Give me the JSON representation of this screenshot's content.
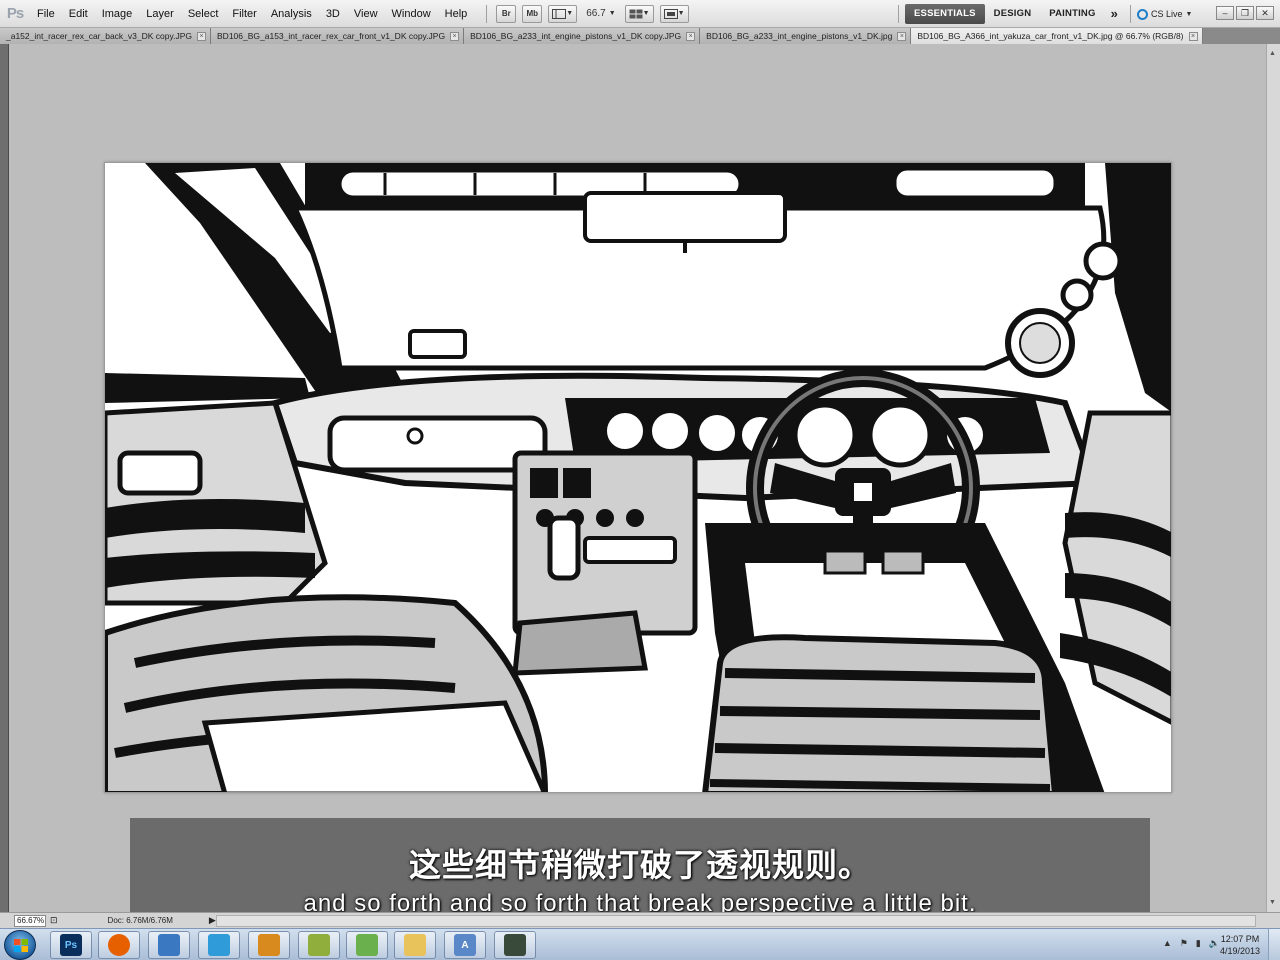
{
  "app": {
    "name": "Ps"
  },
  "menu": [
    "File",
    "Edit",
    "Image",
    "Layer",
    "Select",
    "Filter",
    "Analysis",
    "3D",
    "View",
    "Window",
    "Help"
  ],
  "toolbar": {
    "bridge_label": "Br",
    "minibridge_label": "Mb",
    "zoom_value": "66.7"
  },
  "workspaces": {
    "active": "ESSENTIALS",
    "items": [
      "ESSENTIALS",
      "DESIGN",
      "PAINTING"
    ],
    "more": "»",
    "cs_live": "CS Live"
  },
  "tabs": [
    {
      "label": "_a152_int_racer_rex_car_back_v3_DK copy.JPG",
      "active": false
    },
    {
      "label": "BD106_BG_a153_int_racer_rex_car_front_v1_DK copy.JPG",
      "active": false
    },
    {
      "label": "BD106_BG_a233_int_engine_pistons_v1_DK copy.JPG",
      "active": false
    },
    {
      "label": "BD106_BG_a233_int_engine_pistons_v1_DK.jpg",
      "active": false
    },
    {
      "label": "BD106_BG_A366_int_yakuza_car_front_v1_DK.jpg @ 66.7% (RGB/8)",
      "active": true
    }
  ],
  "subtitle": {
    "chinese": "这些细节稍微打破了透视规则。",
    "english": "and so forth and so forth that break perspective a little bit."
  },
  "status": {
    "zoom": "66.67%",
    "doc_info": "Doc: 6.76M/6.76M"
  },
  "taskbar": {
    "apps": [
      {
        "name": "photoshop",
        "label": "Ps",
        "color": "#0a2e5c",
        "text_color": "#6fc3ff"
      },
      {
        "name": "firefox",
        "label": "",
        "color": "#e66000"
      },
      {
        "name": "app-3",
        "label": "",
        "color": "#3b78c2"
      },
      {
        "name": "app-4",
        "label": "",
        "color": "#2f9bd8"
      },
      {
        "name": "app-5",
        "label": "",
        "color": "#d88a1f"
      },
      {
        "name": "app-6",
        "label": "",
        "color": "#8fae3c"
      },
      {
        "name": "app-7",
        "label": "",
        "color": "#6ab04c"
      },
      {
        "name": "explorer",
        "label": "",
        "color": "#e8c25a"
      },
      {
        "name": "app-9",
        "label": "A",
        "color": "#5a87c7"
      },
      {
        "name": "app-10",
        "label": "",
        "color": "#3a4a3a"
      }
    ],
    "time": "12:07 PM",
    "date": "4/19/2013"
  }
}
